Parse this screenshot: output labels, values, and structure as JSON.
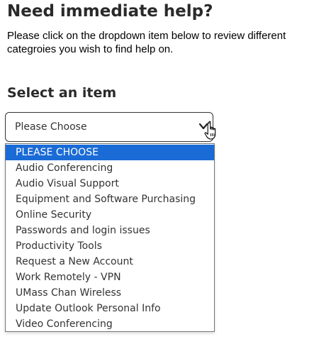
{
  "heading": "Need immediate help?",
  "intro": "Please click on the dropdown item below to review different categroies you wish to find help on.",
  "select_label": "Select an item",
  "select": {
    "value": "Please Choose",
    "options": [
      "PLEASE CHOOSE",
      "Audio Conferencing",
      "Audio Visual Support",
      "Equipment and Software Purchasing",
      "Online Security",
      "Passwords and login issues",
      "Productivity Tools",
      "Request a New Account",
      "Work Remotely - VPN",
      "UMass Chan Wireless",
      "Update Outlook Personal Info",
      "Video Conferencing"
    ],
    "highlighted_index": 0,
    "highlight_color": "#1a6bd6"
  },
  "icons": {
    "chevron": "chevron-down-icon",
    "cursor": "hand-pointer-cursor-icon"
  }
}
